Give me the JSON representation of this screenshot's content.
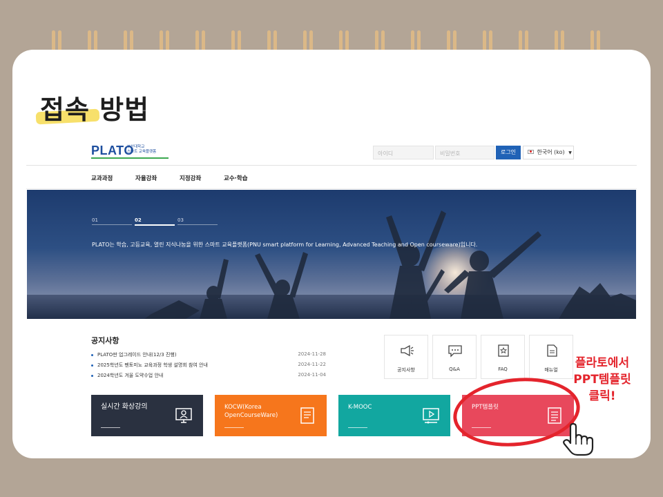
{
  "slide": {
    "headline": "접속 방법",
    "callout_lines": [
      "플라토에서",
      "PPT템플릿",
      "클릭!"
    ]
  },
  "site": {
    "logo": {
      "main": "PLATO",
      "sub_line1": "부산대학교",
      "sub_line2": "스마트 교육플랫폼"
    },
    "login": {
      "id_placeholder": "아이디",
      "pw_placeholder": "비밀번호",
      "button": "로그인"
    },
    "language": "한국어 (ko)",
    "menu": [
      "교과과정",
      "자율강좌",
      "지정강좌",
      "교수·학습"
    ],
    "banner": {
      "slides": [
        "01",
        "02",
        "03"
      ],
      "active_slide": "02",
      "text": "PLATO는 학습, 고등교육, 열린 지식나눔을 위한 스마트 교육플랫폼(PNU smart platform for Learning, Advanced Teaching and Open courseware)입니다."
    },
    "notices": {
      "title": "공지사항",
      "items": [
        {
          "title": "PLATO판 업그레이드 안내(12/3 진행)",
          "date": "2024-11-28"
        },
        {
          "title": "2025학년도 펜토미노 교육과정 학생 설명회 참여 안내",
          "date": "2024-11-22"
        },
        {
          "title": "2024학년도 겨울 도약수업 안내",
          "date": "2024-11-04"
        }
      ]
    },
    "quick_links": [
      {
        "label": "공지사항",
        "icon": "megaphone-icon"
      },
      {
        "label": "Q&A",
        "icon": "chat-bubble-icon"
      },
      {
        "label": "FAQ",
        "icon": "book-star-icon"
      },
      {
        "label": "매뉴얼",
        "icon": "document-icon"
      }
    ],
    "tiles": [
      {
        "label": "실시간 화상강의",
        "color": "#2a3140",
        "icon": "monitor-user-icon"
      },
      {
        "label": "KOCW(Korea OpenCourseWare)",
        "color": "#f6761c",
        "icon": "document-icon"
      },
      {
        "label": "K-MOOC",
        "color": "#12a7a0",
        "icon": "play-screen-icon"
      },
      {
        "label": "PPT템플릿",
        "color": "#e8485c",
        "icon": "document-lines-icon"
      }
    ]
  },
  "colors": {
    "accent_red": "#e4242c",
    "brand_blue": "#1d4e9e",
    "highlight_yellow": "#f7e06b"
  }
}
